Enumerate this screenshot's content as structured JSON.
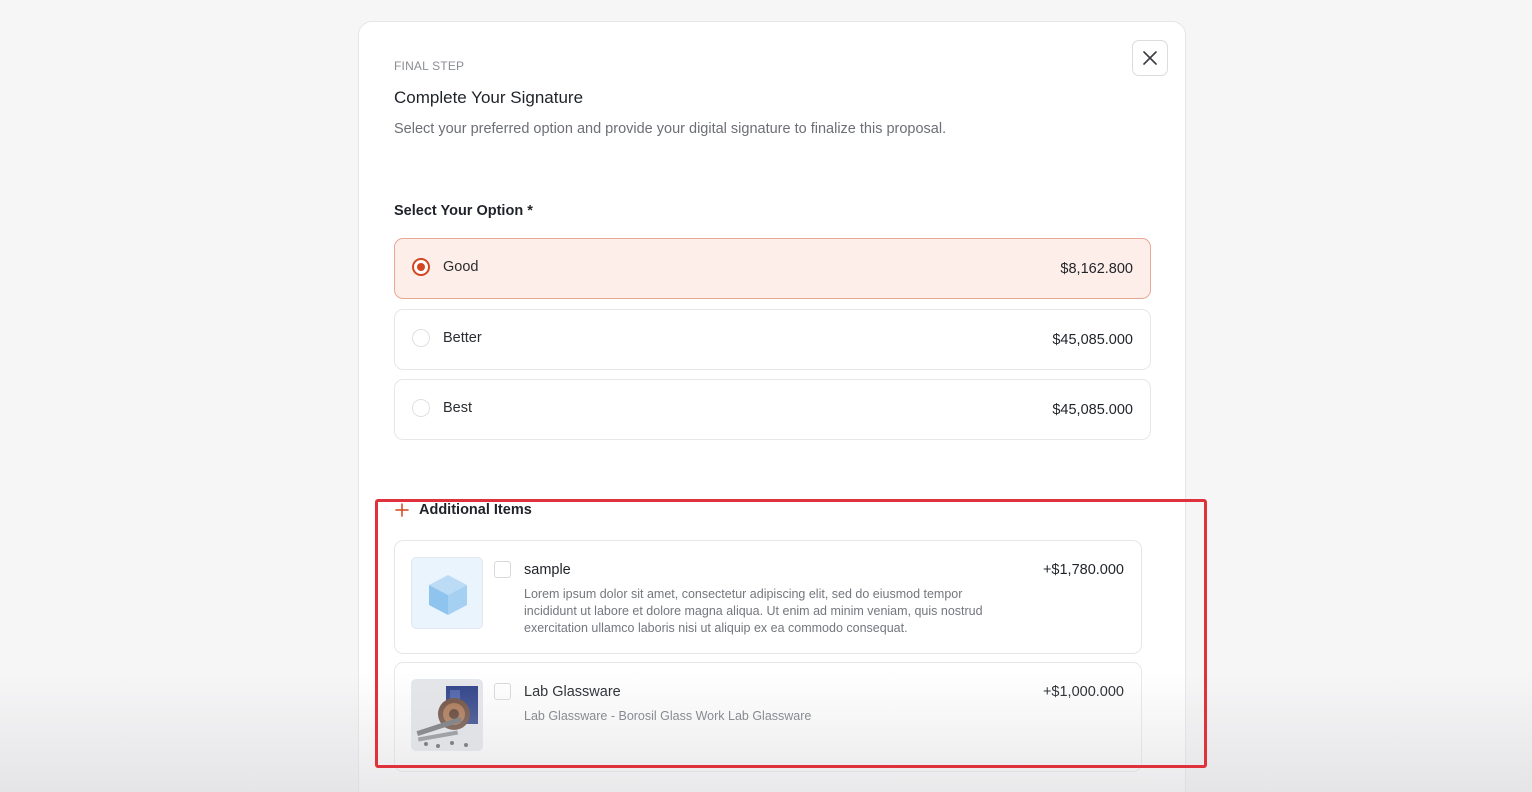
{
  "modal": {
    "eyebrow": "FINAL STEP",
    "title": "Complete Your Signature",
    "subtitle": "Select your preferred option and provide your digital signature to finalize this proposal."
  },
  "options_section": {
    "label": "Select Your Option *",
    "options": [
      {
        "label": "Good",
        "price": "$8,162.800",
        "selected": true
      },
      {
        "label": "Better",
        "price": "$45,085.000",
        "selected": false
      },
      {
        "label": "Best",
        "price": "$45,085.000",
        "selected": false
      }
    ]
  },
  "additional_items": {
    "title": "Additional Items",
    "items": [
      {
        "name": "sample",
        "price": "+$1,780.000",
        "description": "Lorem ipsum dolor sit amet, consectetur adipiscing elit, sed do eiusmod tempor incididunt ut labore et dolore magna aliqua. Ut enim ad minim veniam, quis nostrud exercitation ullamco laboris nisi ut aliquip ex ea commodo consequat.",
        "thumb_icon": "cube-icon",
        "checked": false
      },
      {
        "name": "Lab Glassware",
        "price": "+$1,000.000",
        "description": "Lab Glassware - Borosil Glass Work Lab Glassware",
        "thumb_icon": "product-photo",
        "checked": false
      }
    ]
  },
  "colors": {
    "accent": "#d4461f",
    "selected_bg": "#fdeee9",
    "highlight_border": "#e0323c"
  }
}
